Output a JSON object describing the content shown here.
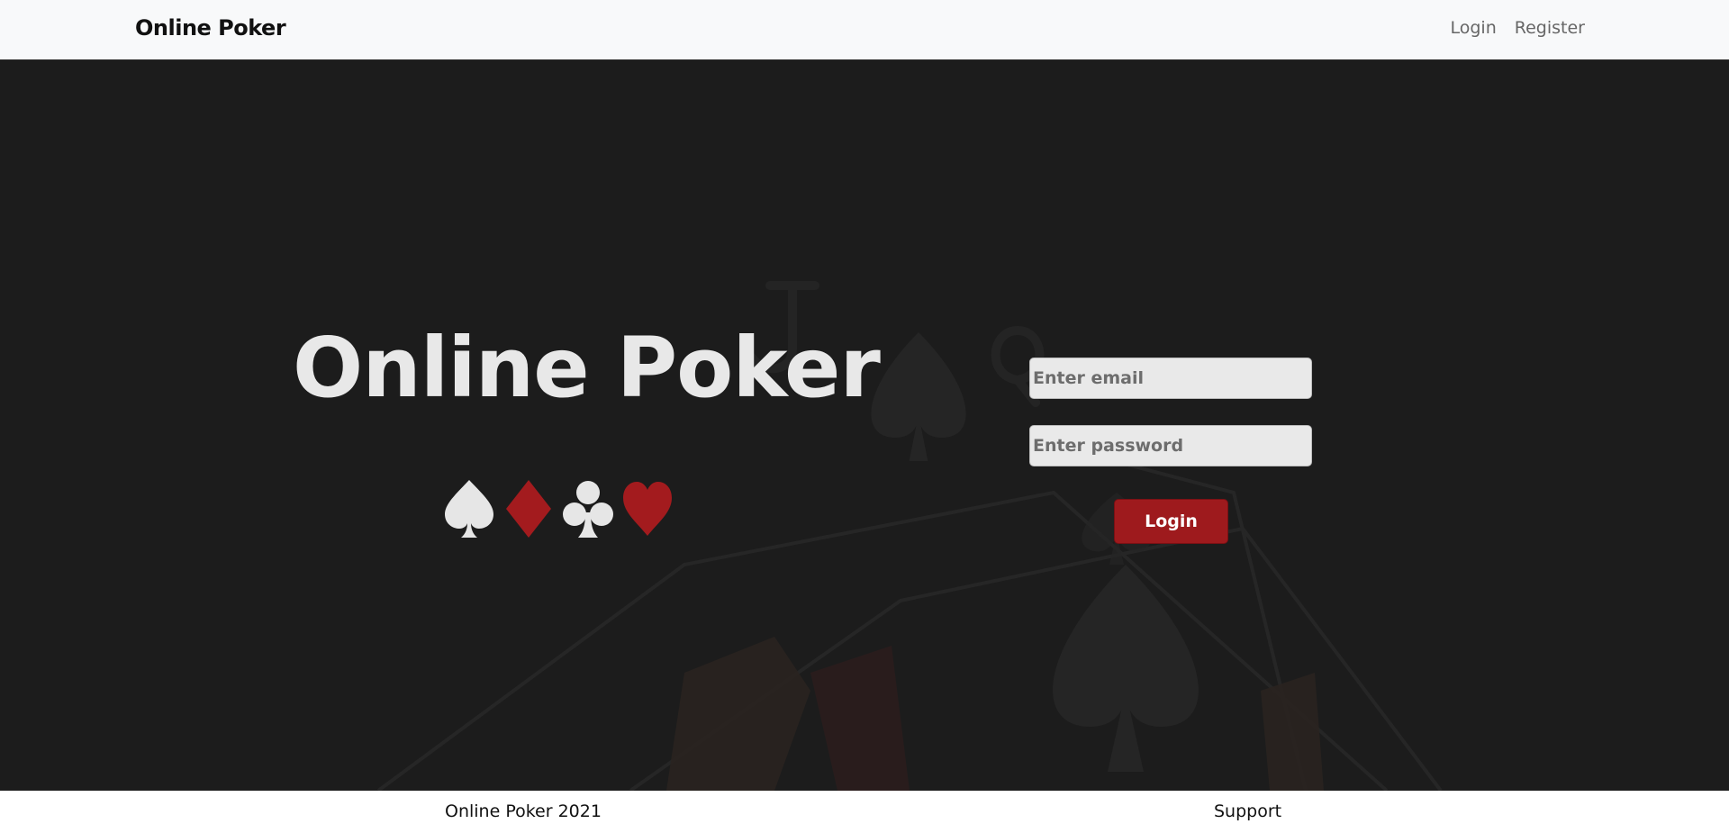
{
  "navbar": {
    "brand": "Online Poker",
    "links": [
      {
        "label": "Login"
      },
      {
        "label": "Register"
      }
    ]
  },
  "hero": {
    "title": "Online Poker",
    "suits": [
      {
        "icon": "spade-icon",
        "color": "#e6e6e6"
      },
      {
        "icon": "diamond-icon",
        "color": "#a31b1e"
      },
      {
        "icon": "club-icon",
        "color": "#e6e6e6"
      },
      {
        "icon": "heart-icon",
        "color": "#a31b1e"
      }
    ]
  },
  "login": {
    "email_placeholder": "Enter email",
    "password_placeholder": "Enter password",
    "button_label": "Login"
  },
  "footer": {
    "copyright": "Online Poker 2021",
    "support": "Support"
  },
  "colors": {
    "background": "#1c1c1c",
    "accent": "#9e1a1d",
    "navbar": "#f8f9fa"
  }
}
